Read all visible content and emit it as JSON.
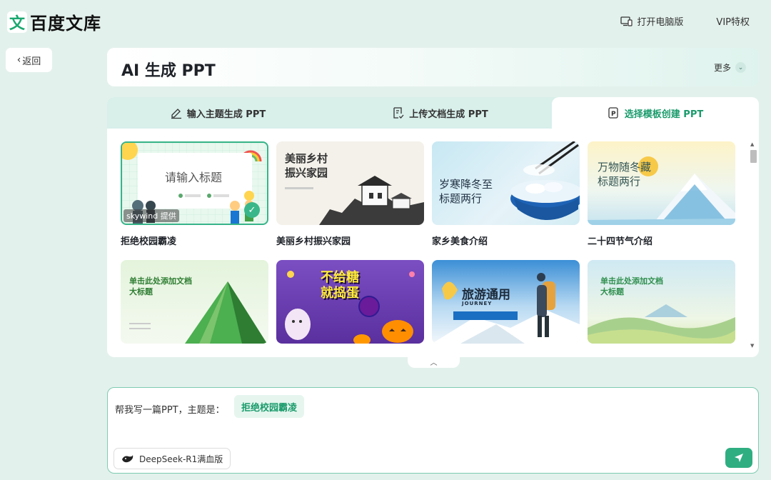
{
  "header": {
    "logo_glyph": "文",
    "logo_text": "百度文库",
    "desktop_link": "打开电脑版",
    "vip_link": "VIP特权"
  },
  "back_label": "返回",
  "page_title": "AI 生成 PPT",
  "more_label": "更多",
  "tabs": [
    {
      "label": "输入主题生成 PPT",
      "icon": "pen-edit-icon",
      "active": false
    },
    {
      "label": "上传文档生成 PPT",
      "icon": "document-upload-icon",
      "active": false
    },
    {
      "label": "选择模板创建 PPT",
      "icon": "ppt-template-icon",
      "active": true
    }
  ],
  "templates": [
    {
      "label": "拒绝校园霸凌",
      "thumb_title": "请输入标题",
      "provider": "skywind 提供",
      "selected": true
    },
    {
      "label": "美丽乡村振兴家园",
      "thumb_title": "美丽乡村\n振兴家园"
    },
    {
      "label": "家乡美食介绍",
      "thumb_title": "岁寒降冬至\n标题两行"
    },
    {
      "label": "二十四节气介绍",
      "thumb_title": "万物随冬藏\n标题两行"
    },
    {
      "label": "",
      "thumb_title": "单击此处添加文档\n大标题"
    },
    {
      "label": "",
      "thumb_title": "不给糖\n就捣蛋"
    },
    {
      "label": "",
      "thumb_title": "旅游通用",
      "thumb_sub": "JOURNEY"
    },
    {
      "label": "",
      "thumb_title": "单击此处添加文档\n大标题"
    }
  ],
  "prompt": {
    "prefix": "帮我写一篇PPT，主题是：",
    "topic": "拒绝校园霸凌",
    "model": "DeepSeek-R1满血版"
  },
  "colors": {
    "accent": "#2fae82",
    "background": "#e3f1ec",
    "tab_bar": "#d8efea"
  }
}
